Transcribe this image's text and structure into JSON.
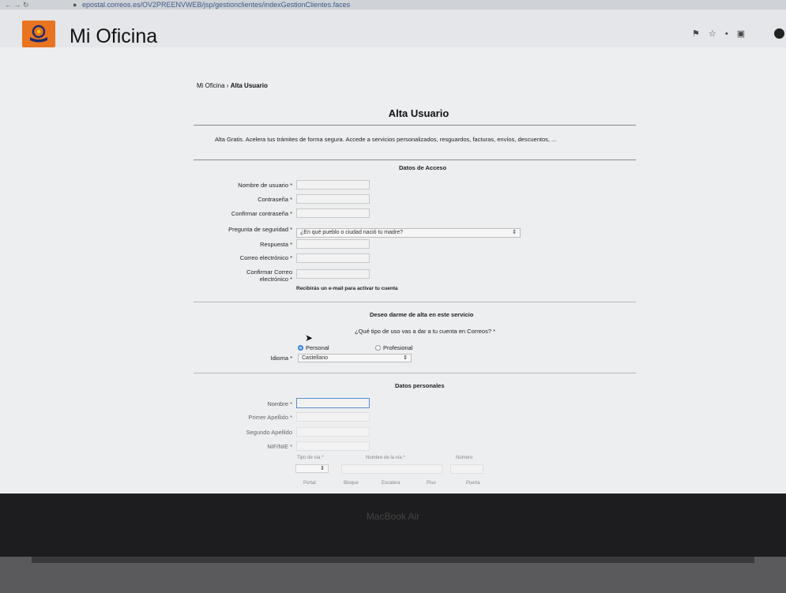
{
  "browser": {
    "url": "epostal.correos.es/OV2PREENVWEB/jsp/gestionclientes/indexGestionClientes.faces",
    "nav_icons": "← → ↻",
    "lock_icon": "lock-icon",
    "extension_icons": "⚑ ☆ • ▣"
  },
  "app": {
    "title": "Mi Oficina",
    "logo_color": "#e8741f"
  },
  "breadcrumb": {
    "home": "Mi Oficina",
    "separator": "›",
    "current": "Alta Usuario"
  },
  "page_title": "Alta Usuario",
  "intro_text": "Alta Gratis. Acelera tus trámites de forma segura. Accede a servicios personalizados, resguardos, facturas, envíos, descuentos, ...",
  "access": {
    "section_title": "Datos de Acceso",
    "username_label": "Nombre de usuario *",
    "password_label": "Contraseña *",
    "confirm_password_label": "Confirmar contraseña *",
    "security_question_label": "Pregunta de seguridad *",
    "security_question_value": "¿En qué pueblo o ciudad nació tu madre?",
    "answer_label": "Respuesta *",
    "email_label": "Correo electrónico *",
    "confirm_email_label_1": "Confirmar Correo",
    "confirm_email_label_2": "electrónico *",
    "email_hint": "Recibirás un e-mail para activar tu cuenta"
  },
  "service": {
    "section_title": "Deseo darme de alta en este servicio",
    "usage_question": "¿Qué tipo de uso vas a dar a tu cuenta en Correos? *",
    "option_personal": "Personal",
    "option_profesional": "Profesional",
    "language_label": "Idioma *",
    "language_value": "Castellano"
  },
  "personal": {
    "section_title": "Datos personales",
    "name_label": "Nombre *",
    "surname1_label": "Primer Apellido *",
    "surname2_label": "Segundo Apellido",
    "nif_label": "NIF/NIE *",
    "street_type_label": "Tipo de vía *",
    "street_name_label": "Nombre de la vía *",
    "number_label": "Número",
    "portal_label": "Portal",
    "block_label": "Bloque",
    "stairs_label": "Escalera",
    "floor_label": "Piso",
    "door_label": "Puerta"
  },
  "laptop": {
    "brand": "MacBook Air"
  }
}
